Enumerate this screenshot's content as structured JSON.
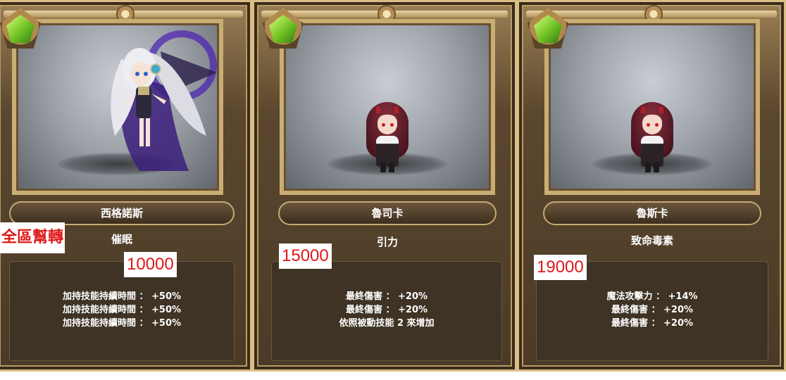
{
  "cards": [
    {
      "name": "西格諾斯",
      "skill": "催眠",
      "price": "10000",
      "stats": [
        "加持技能持續時間 ： +50%",
        "加持技能持續時間 ： +50%",
        "加持技能持續時間 ： +50%"
      ]
    },
    {
      "name": "魯司卡",
      "skill": "引力",
      "price": "15000",
      "stats": [
        "最終傷害 ： +20%",
        "最終傷害 ： +20%",
        "依照被動技能 2 來增加"
      ]
    },
    {
      "name": "魯斯卡",
      "skill": "致命毒素",
      "price": "19000",
      "stats": [
        "魔法攻擊力 ： +14%",
        "最終傷害 ： +20%",
        "最終傷害 ： +20%"
      ]
    }
  ],
  "badge": "全區幫轉",
  "colors": {
    "price_text": "#e01818",
    "gem": "#72c225",
    "frame": "#c9ae74"
  }
}
